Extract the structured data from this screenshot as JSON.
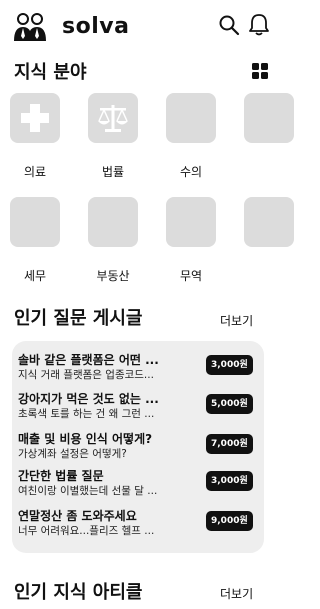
{
  "app": {
    "name": "solva"
  },
  "icons": {
    "logo": "people-icon",
    "search": "search-icon",
    "notifications": "bell-icon",
    "grid": "grid-icon"
  },
  "knowledge_section": {
    "title": "지식 분야",
    "categories": [
      {
        "label": "의료",
        "icon": "medical-cross-icon"
      },
      {
        "label": "법률",
        "icon": "scales-icon"
      },
      {
        "label": "수의",
        "icon": ""
      },
      {
        "label": "",
        "icon": ""
      },
      {
        "label": "세무",
        "icon": ""
      },
      {
        "label": "부동산",
        "icon": ""
      },
      {
        "label": "무역",
        "icon": ""
      },
      {
        "label": "",
        "icon": ""
      }
    ]
  },
  "popular_questions": {
    "title": "인기 질문 게시글",
    "more_label": "더보기",
    "items": [
      {
        "title": "솔바 같은 플랫폼은 어떤 ...",
        "subtitle": "지식 거래 플랫폼은 업종코드...",
        "price": "3,000원"
      },
      {
        "title": "강아지가 먹은 것도 없는 ...",
        "subtitle": "초록색 토를 하는 건 왜 그런 ...",
        "price": "5,000원"
      },
      {
        "title": "매출 및 비용 인식 어떻게?",
        "subtitle": "가상계좌 설정은 어떻게?",
        "price": "7,000원"
      },
      {
        "title": "간단한 법률 질문",
        "subtitle": "여친이랑 이별했는데 선물 달 ...",
        "price": "3,000원"
      },
      {
        "title": "연말정산 좀 도와주세요",
        "subtitle": "너무 어려워요...플리즈 헬프 ...",
        "price": "9,000원"
      }
    ]
  },
  "popular_articles": {
    "title": "인기 지식 아티클",
    "more_label": "더보기"
  },
  "colors": {
    "tile": "#dcdcdc",
    "panel": "#eeeeee",
    "badge": "#111111"
  }
}
